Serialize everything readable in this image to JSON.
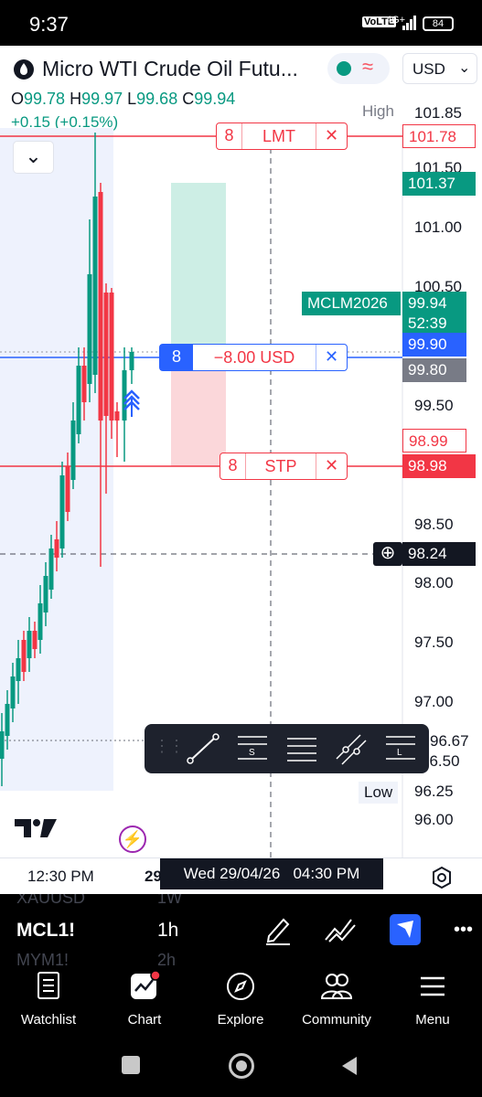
{
  "status_bar": {
    "time": "9:37",
    "network": "VoLTE",
    "signal": "4G+",
    "battery": "84"
  },
  "header": {
    "symbol_title": "Micro WTI Crude Oil Futu...",
    "currency": "USD",
    "open_label": "O",
    "open": "99.78",
    "high_label": "H",
    "high": "99.97",
    "low_label": "L",
    "low": "99.68",
    "close_label": "C",
    "close": "99.94",
    "change": "+0.15 (+0.15%)"
  },
  "price_scale": {
    "high_label": "High",
    "high_value": "101.85",
    "ticks": [
      "101.50",
      "101.00",
      "100.50",
      "99.50",
      "98.50",
      "98.00",
      "97.50",
      "97.00",
      "96.50",
      "96.00"
    ],
    "low_label": "Low",
    "low_value": "96.25",
    "limit_tag": "101.78",
    "green_tag": "101.37",
    "symbol_tag": "MCLM2026",
    "last_price": "99.94",
    "countdown": "52:39",
    "position_tag": "99.90",
    "grey_tag": "99.80",
    "stop_outline_tag": "98.99",
    "stop_tag": "98.98",
    "crosshair_tag": "98.24",
    "partial_tag": "96.67"
  },
  "orders": {
    "limit": {
      "qty": "8",
      "label": "LMT"
    },
    "position": {
      "qty": "8",
      "label": "−8.00 USD"
    },
    "stop": {
      "qty": "8",
      "label": "STP"
    }
  },
  "time_axis": {
    "left_time": "12:30 PM",
    "partial": "29",
    "crosshair_time": "Wed 29/04/26   04:30 PM"
  },
  "symbol_row": {
    "ghost_top_left": "XAUUSD",
    "ghost_top_mid": "1W",
    "symbol": "MCL1!",
    "interval": "1h",
    "ghost_bottom_left": "MYM1!",
    "ghost_bottom_mid": "2h",
    "more": "•••"
  },
  "nav": [
    {
      "label": "Watchlist",
      "icon": "watchlist-icon"
    },
    {
      "label": "Chart",
      "icon": "chart-icon"
    },
    {
      "label": "Explore",
      "icon": "compass-icon"
    },
    {
      "label": "Community",
      "icon": "community-icon"
    },
    {
      "label": "Menu",
      "icon": "menu-icon"
    }
  ],
  "colors": {
    "up": "#089981",
    "down": "#f23645",
    "accent": "#2962ff",
    "dark": "#1e222d"
  }
}
